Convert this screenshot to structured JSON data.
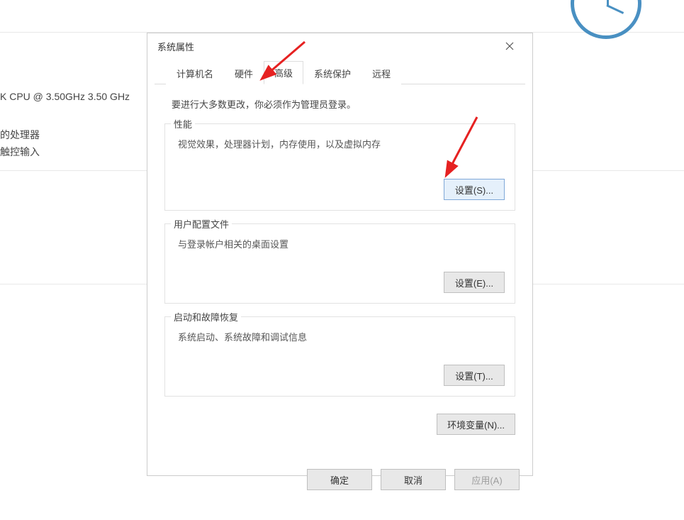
{
  "background": {
    "cpu_text": "K CPU @ 3.50GHz   3.50 GHz",
    "processor_text": "的处理器",
    "touch_text": "触控输入"
  },
  "dialog": {
    "title": "系统属性",
    "tabs": [
      "计算机名",
      "硬件",
      "高级",
      "系统保护",
      "远程"
    ],
    "active_tab_index": 2,
    "admin_note": "要进行大多数更改，你必须作为管理员登录。",
    "groups": {
      "performance": {
        "title": "性能",
        "desc": "视觉效果，处理器计划，内存使用，以及虚拟内存",
        "button": "设置(S)..."
      },
      "profiles": {
        "title": "用户配置文件",
        "desc": "与登录帐户相关的桌面设置",
        "button": "设置(E)..."
      },
      "startup": {
        "title": "启动和故障恢复",
        "desc": "系统启动、系统故障和调试信息",
        "button": "设置(T)..."
      }
    },
    "env_button": "环境变量(N)...",
    "buttons": {
      "ok": "确定",
      "cancel": "取消",
      "apply": "应用(A)"
    }
  }
}
